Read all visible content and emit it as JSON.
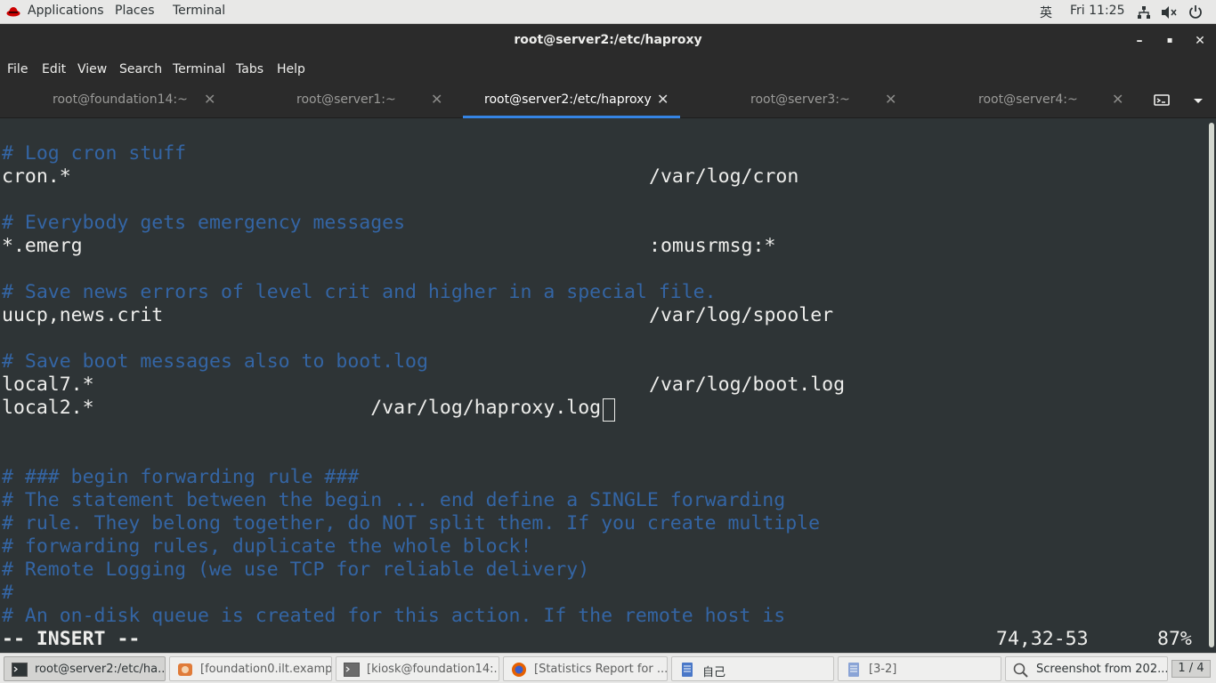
{
  "topbar": {
    "applications": "Applications",
    "places": "Places",
    "terminal": "Terminal",
    "input_method": "英",
    "clock": "Fri 11:25",
    "icons": [
      "network-icon",
      "volume-icon",
      "power-icon"
    ]
  },
  "window": {
    "title": "root@server2:/etc/haproxy",
    "buttons": {
      "minimize": "–",
      "maximize": "▪",
      "close": "✕"
    }
  },
  "menubar": [
    "File",
    "Edit",
    "View",
    "Search",
    "Terminal",
    "Tabs",
    "Help"
  ],
  "tabs": [
    {
      "label": "root@foundation14:~",
      "active": false
    },
    {
      "label": "root@server1:~",
      "active": false
    },
    {
      "label": "root@server2:/etc/haproxy",
      "active": true
    },
    {
      "label": "root@server3:~",
      "active": false
    },
    {
      "label": "root@server4:~",
      "active": false
    }
  ],
  "terminal": {
    "lines": [
      {
        "text": "# Log cron stuff",
        "comment": true
      },
      {
        "text": "cron.*",
        "target": "/var/log/cron"
      },
      {
        "text": ""
      },
      {
        "text": "# Everybody gets emergency messages",
        "comment": true
      },
      {
        "text": "*.emerg",
        "target": ":omusrmsg:*"
      },
      {
        "text": ""
      },
      {
        "text": "# Save news errors of level crit and higher in a special file.",
        "comment": true
      },
      {
        "text": "uucp,news.crit",
        "target": "/var/log/spooler"
      },
      {
        "text": ""
      },
      {
        "text": "# Save boot messages also to boot.log",
        "comment": true
      },
      {
        "text": "local7.*",
        "target": "/var/log/boot.log"
      },
      {
        "text": "local2.*                        /var/log/haproxy.log"
      },
      {
        "text": ""
      },
      {
        "text": ""
      },
      {
        "text": "# ### begin forwarding rule ###",
        "comment": true
      },
      {
        "text": "# The statement between the begin ... end define a SINGLE forwarding",
        "comment": true
      },
      {
        "text": "# rule. They belong together, do NOT split them. If you create multiple",
        "comment": true
      },
      {
        "text": "# forwarding rules, duplicate the whole block!",
        "comment": true
      },
      {
        "text": "# Remote Logging (we use TCP for reliable delivery)",
        "comment": true
      },
      {
        "text": "#",
        "comment": true
      },
      {
        "text": "# An on-disk queue is created for this action. If the remote host is",
        "comment": true
      }
    ],
    "mode": "-- INSERT --",
    "position": "74,32-53",
    "percent": "87%"
  },
  "taskbar": {
    "tasks": [
      {
        "label": "root@server2:/etc/ha...",
        "icon": "terminal-icon",
        "active": true
      },
      {
        "label": "[foundation0.ilt.exampl...",
        "icon": "viewer-icon",
        "active": false
      },
      {
        "label": "[kiosk@foundation14:...",
        "icon": "terminal-icon",
        "active": false
      },
      {
        "label": "[Statistics Report for ...",
        "icon": "firefox-icon",
        "active": false
      },
      {
        "label": "自己",
        "icon": "document-icon",
        "active": false
      },
      {
        "label": "[3-2]",
        "icon": "document-icon",
        "active": false
      },
      {
        "label": "Screenshot from 202...",
        "icon": "screenshot-icon",
        "active": false
      }
    ],
    "pager": "1 / 4"
  }
}
